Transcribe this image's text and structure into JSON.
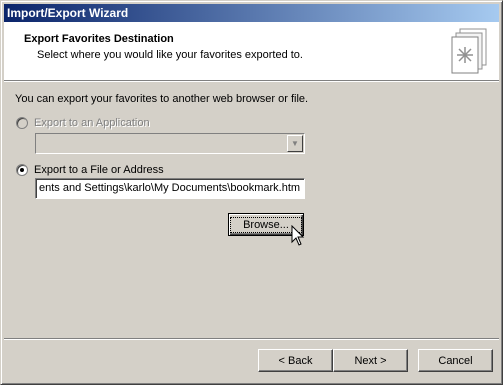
{
  "window": {
    "title": "Import/Export Wizard"
  },
  "header": {
    "title": "Export Favorites Destination",
    "subtitle": "Select where you would like your favorites exported to.",
    "icon": "favorites-export-icon"
  },
  "body": {
    "intro": "You can export your favorites to another web browser or file.",
    "option_application": {
      "label": "Export to an Application",
      "enabled": false,
      "selected": false
    },
    "application_combo": {
      "value": ""
    },
    "option_file": {
      "label": "Export to a File or Address",
      "enabled": true,
      "selected": true
    },
    "file_path": {
      "value": "ents and Settings\\karlo\\My Documents\\bookmark.htm"
    },
    "browse_label": "Browse..."
  },
  "footer": {
    "back_label": "< Back",
    "next_label": "Next >",
    "cancel_label": "Cancel"
  }
}
